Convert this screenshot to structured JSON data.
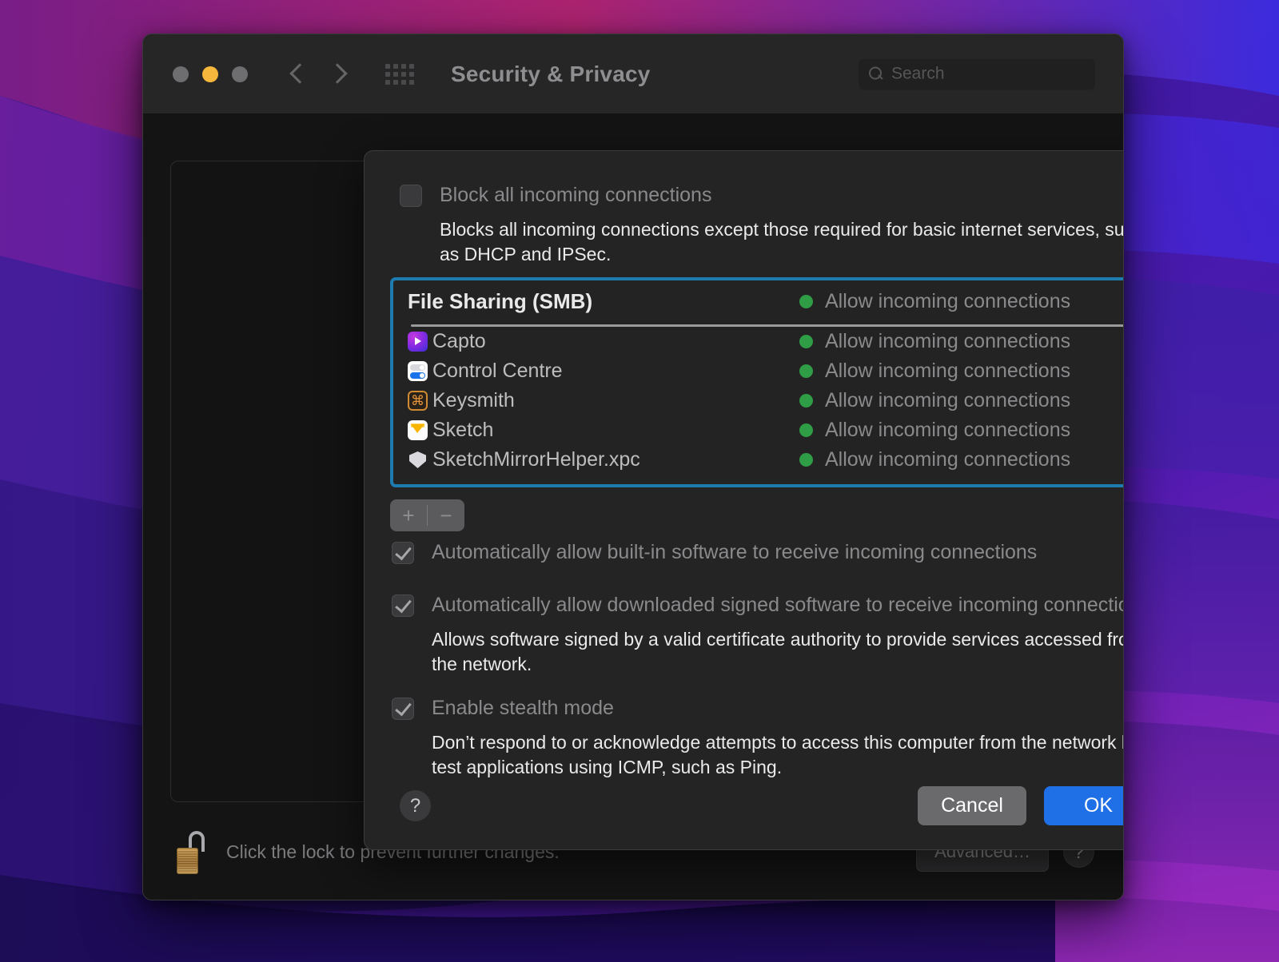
{
  "window": {
    "title": "Security & Privacy",
    "traffic_lights": [
      "close",
      "minimize",
      "zoom"
    ],
    "nav": {
      "back": "back",
      "forward": "forward"
    },
    "grid_icon": "grid-icon",
    "search": {
      "placeholder": "Search",
      "value": ""
    }
  },
  "sheet": {
    "block_all": {
      "label": "Block all incoming connections",
      "checked": false,
      "description": "Blocks all incoming connections except those required for basic internet services, such as DHCP and IPSec."
    },
    "list_header": {
      "name": "File Sharing (SMB)",
      "status": "Allow incoming connections"
    },
    "apps": [
      {
        "name": "Capto",
        "icon": "capto-icon",
        "status": "Allow incoming connections"
      },
      {
        "name": "Control Centre",
        "icon": "control-centre-icon",
        "status": "Allow incoming connections"
      },
      {
        "name": "Keysmith",
        "icon": "keysmith-icon",
        "status": "Allow incoming connections"
      },
      {
        "name": "Sketch",
        "icon": "sketch-icon",
        "status": "Allow incoming connections"
      },
      {
        "name": "SketchMirrorHelper.xpc",
        "icon": "shield-icon",
        "status": "Allow incoming connections"
      }
    ],
    "add_button": "+",
    "remove_button": "−",
    "builtin": {
      "label": "Automatically allow built-in software to receive incoming connections",
      "checked": true
    },
    "signed": {
      "label": "Automatically allow downloaded signed software to receive incoming connections",
      "checked": true,
      "description": "Allows software signed by a valid certificate authority to provide services accessed from the network."
    },
    "stealth": {
      "label": "Enable stealth mode",
      "checked": true,
      "description": "Don’t respond to or acknowledge attempts to access this computer from the network by test applications using ICMP, such as Ping."
    },
    "help_button": "?",
    "cancel_button": "Cancel",
    "ok_button": "OK"
  },
  "bottom_bar": {
    "lock_icon": "unlocked-padlock-icon",
    "lock_text": "Click the lock to prevent further changes.",
    "advanced_button": "Advanced…",
    "help_button": "?"
  },
  "colors": {
    "accent_blue": "#1f6fe6",
    "focus_ring": "#1d7bb0",
    "status_green": "#2f9c46",
    "minimize_yellow": "#f6b83c",
    "window_bg": "#1e1e1e",
    "sheet_bg": "#242425"
  }
}
